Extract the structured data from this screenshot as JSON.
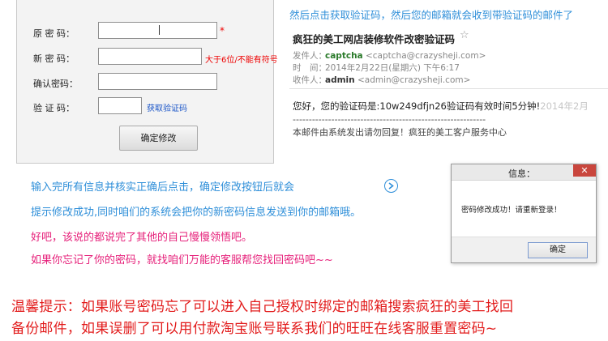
{
  "form": {
    "original_password_label": "原 密 码：",
    "required_mark": "*",
    "new_password_label": "新 密 码：",
    "new_password_hint": "大于6位/不能有符号",
    "confirm_password_label": "确认密码：",
    "verification_code_label": "验 证 码：",
    "get_code_link": "获取验证码",
    "submit_button": "确定修改"
  },
  "email": {
    "top_note": "然后点击获取验证码，然后您的邮箱就会收到带验证码的邮件了",
    "subject": "疯狂的美工网店装修软件改密验证码",
    "star_icon": "star-icon",
    "sender_label": "发件人：",
    "sender_name": "captcha",
    "sender_address": "<captcha@crazysheji.com>",
    "time_label": "时　间：",
    "time_value": "2014年2月22日(星期六) 下午6:17",
    "recipient_label": "收件人：",
    "recipient_name": "admin",
    "recipient_address": "<admin@crazysheji.com>",
    "body_text": "您好，您的验证码是:10w249dfjn26验证码有效时间5分钟!",
    "body_fade": "2014年2月",
    "separator": "------------------------------------------------------------",
    "footer": "本邮件由系统发出请勿回复！疯狂的美工客户服务中心"
  },
  "instructions": {
    "line1": "输入完所有信息并核实正确后点击，确定修改按钮后就会",
    "line2": "提示修改成功,同时咱们的系统会把你的新密码信息发送到你的邮箱哦。",
    "line3": "好吧，该说的都说完了其他的自己慢慢领悟吧。",
    "line4": "如果你忘记了你的密码，就找咱们万能的客服帮您找回密码吧~~"
  },
  "dialog": {
    "title": "信息：",
    "close": "✕",
    "message": "密码修改成功！请重新登录！",
    "ok_button": "确定"
  },
  "tip": {
    "line1": "温馨提示：如果账号密码忘了可以进入自己授权时绑定的邮箱搜索疯狂的美工找回",
    "line2": "备份邮件，如果误删了可以用付款淘宝账号联系我们的旺旺在线客服重置密码~"
  },
  "colors": {
    "accent_blue": "#2f8fd9",
    "pink": "#e6207a",
    "red": "#e21b1b"
  }
}
